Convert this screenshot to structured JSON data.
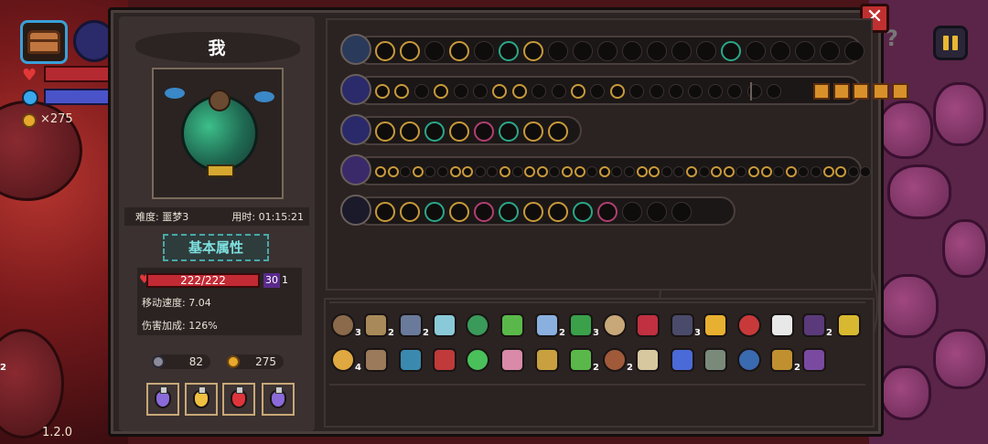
{
  "hud": {
    "gold": "×275",
    "version": "1.2.0"
  },
  "panel": {
    "player_name": "我",
    "difficulty": "难度: 噩梦3",
    "time": "用时: 01:15:21",
    "attr_title": "基本属性",
    "hp": "222/222",
    "shield": "30",
    "shield_extra": "1",
    "move_speed": "移动速度: 7.04",
    "damage_bonus": "伤害加成: 126%",
    "keys": "82",
    "coins": "275",
    "close_label": "✕"
  },
  "potions": [
    {
      "name": "purple-potion-icon",
      "color": "#8a6ad8"
    },
    {
      "name": "gold-potion-icon",
      "color": "#f0c040"
    },
    {
      "name": "red-potion-icon",
      "color": "#e0343c"
    },
    {
      "name": "purple-potion-icon",
      "color": "#8a6ad8"
    }
  ],
  "inventory_counts": [
    {
      "item": 1,
      "count": "3"
    },
    {
      "item": 2,
      "count": "2"
    },
    {
      "item": 3,
      "count": "2"
    },
    {
      "item": 7,
      "count": "2"
    },
    {
      "item": 8,
      "count": "3"
    },
    {
      "item": 11,
      "count": "3"
    },
    {
      "item": 15,
      "count": "2"
    },
    {
      "item": 17,
      "count": "4"
    },
    {
      "item": 24,
      "count": "2"
    },
    {
      "item": 25,
      "count": "2"
    },
    {
      "item": 30,
      "count": "2"
    },
    {
      "item": 33,
      "count": "2"
    }
  ],
  "colors": {
    "panel_bg": "#2c2423",
    "accent_teal": "#7fe0e0",
    "hp_red": "#c22a34",
    "gold": "#e8a82c",
    "close_red": "#c03030"
  }
}
